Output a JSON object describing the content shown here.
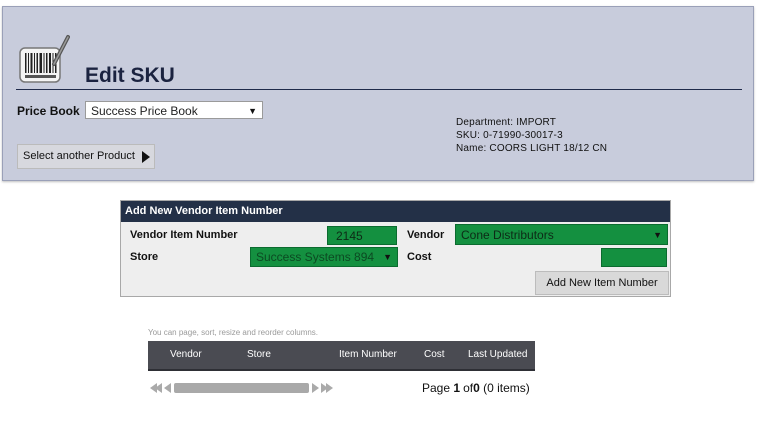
{
  "header": {
    "title": "Edit SKU",
    "price_book_label": "Price Book",
    "price_book_value": "Success Price Book",
    "select_another_label": "Select another Product",
    "department": "Department: IMPORT",
    "sku": "SKU: 0-71990-30017-3",
    "name": "Name: COORS LIGHT 18/12 CN"
  },
  "vendor_form": {
    "title": "Add New Vendor Item Number",
    "vendor_item_number_label": "Vendor Item Number",
    "vendor_item_number_value": "2145",
    "vendor_label": "Vendor",
    "vendor_value": "Cone Distributors",
    "store_label": "Store",
    "store_value": "Success Systems 894",
    "cost_label": "Cost",
    "cost_value": "",
    "add_button_label": "Add New Item Number"
  },
  "grid": {
    "hint": "You can page, sort, resize and reorder columns.",
    "columns": [
      "Vendor",
      "Store",
      "Item Number",
      "Cost",
      "Last Updated"
    ],
    "pager": {
      "prefix": "Page",
      "page": "1",
      "of": "of",
      "total_pages": "0",
      "items": "(0 items)"
    }
  },
  "colors": {
    "header_bg": "#c8ccdc",
    "panel_title_bg": "#233047",
    "green_field": "#149040",
    "grid_header": "#4a4b52"
  },
  "icons": [
    "barcode-icon",
    "chevron-right-icon",
    "first-page-icon",
    "prev-page-icon",
    "next-page-icon",
    "last-page-icon"
  ]
}
